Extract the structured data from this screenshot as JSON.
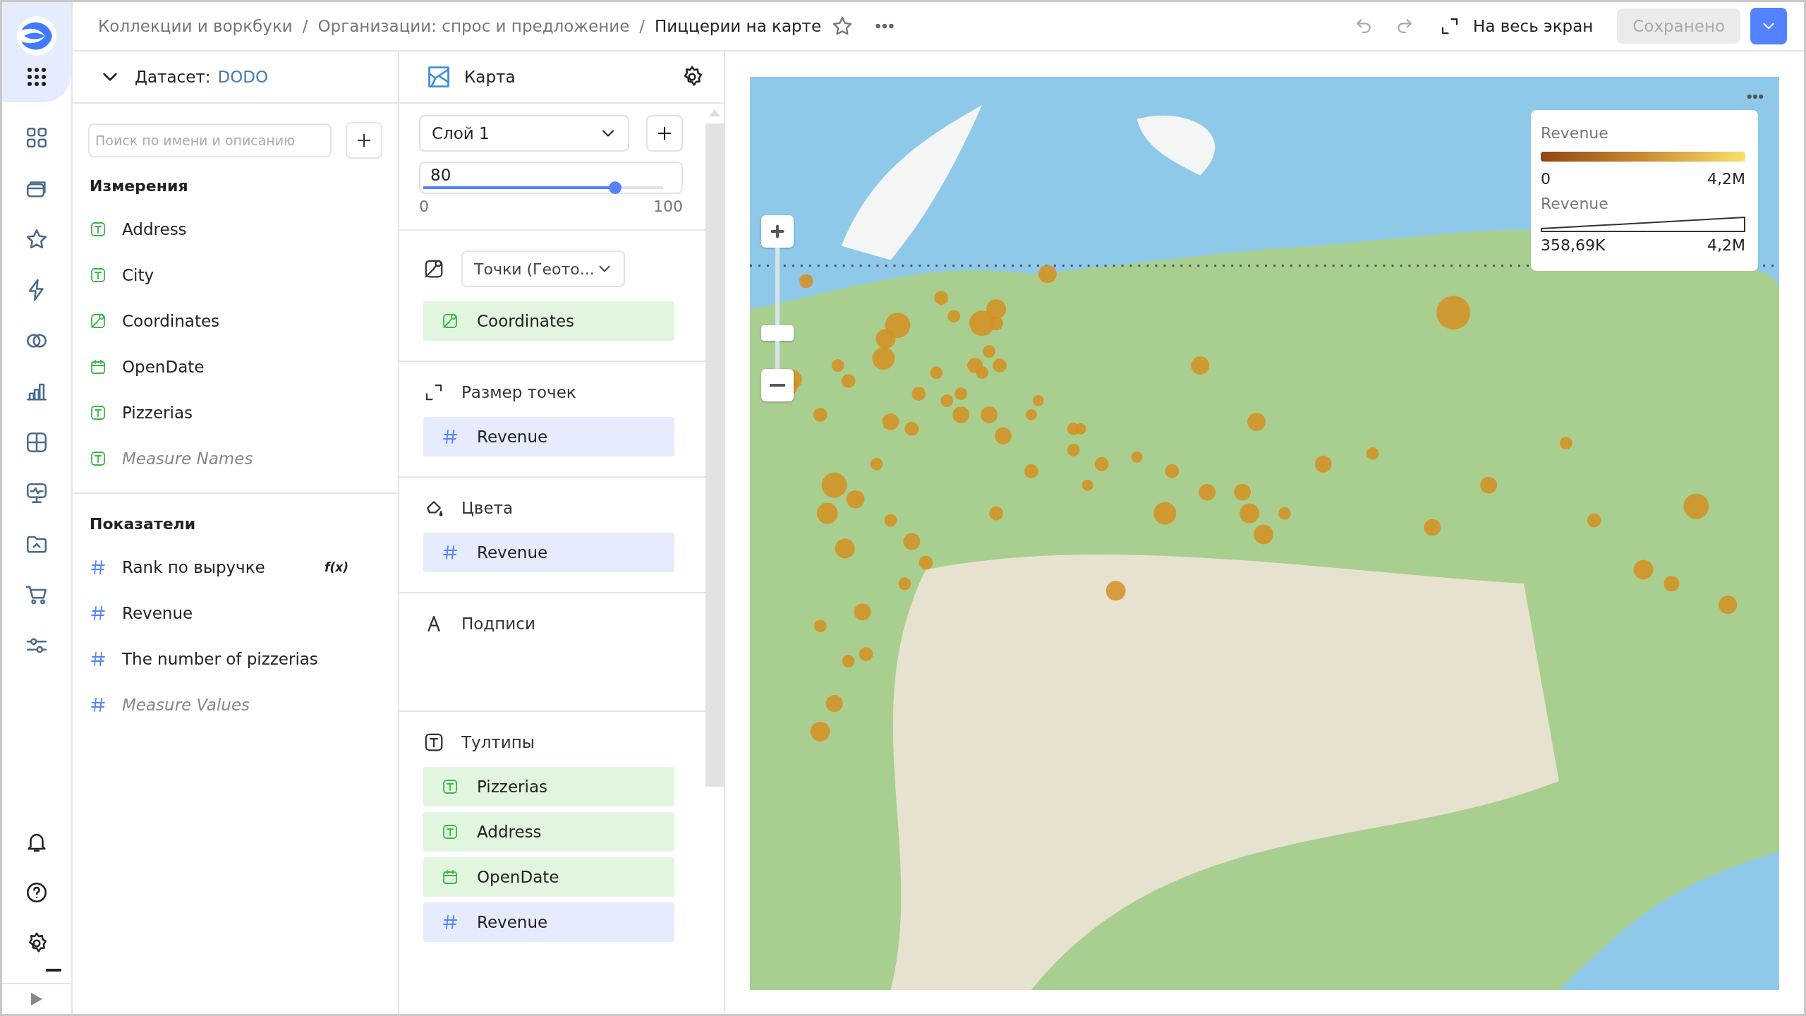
{
  "breadcrumbs": [
    {
      "label": "Коллекции и воркбуки",
      "current": false
    },
    {
      "separator": "/",
      "label": "Организации: спрос и предложение",
      "current": false
    },
    {
      "separator": "/",
      "label": "Пиццерии на карте",
      "current": true
    }
  ],
  "toolbar": {
    "fullscreen": "На весь экран",
    "save": "Сохранено",
    "save_disabled": true
  },
  "dataset": {
    "label": "Датасет:",
    "name": "DODO",
    "search_placeholder": "Поиск по имени и описанию",
    "sections": [
      {
        "title": "Измерения",
        "fields": [
          {
            "name": "Address",
            "kind": "text",
            "virtual": false
          },
          {
            "name": "City",
            "kind": "text",
            "virtual": false
          },
          {
            "name": "Coordinates",
            "kind": "geo",
            "virtual": false
          },
          {
            "name": "OpenDate",
            "kind": "date",
            "virtual": false
          },
          {
            "name": "Pizzerias",
            "kind": "text",
            "virtual": false
          },
          {
            "name": "Measure Names",
            "kind": "text",
            "virtual": true
          }
        ]
      },
      {
        "title": "Показатели",
        "fields": [
          {
            "name": "Rank по выручке",
            "kind": "number",
            "virtual": false,
            "badge": "f(x)"
          },
          {
            "name": "Revenue",
            "kind": "number",
            "virtual": false
          },
          {
            "name": "The number of pizzerias",
            "kind": "number",
            "virtual": false
          },
          {
            "name": "Measure Values",
            "kind": "number",
            "virtual": true
          }
        ]
      }
    ]
  },
  "visualization": {
    "title": "Карта",
    "layer": "Слой 1",
    "opacity": {
      "value": "80",
      "level": 0.8,
      "min": "0",
      "max": "100"
    },
    "sections": [
      {
        "kind": "geotype",
        "select": "Точки (Геото...",
        "items": [
          {
            "name": "Coordinates",
            "kind": "geo"
          }
        ]
      },
      {
        "kind": "size",
        "title": "Размер точек",
        "items": [
          {
            "name": "Revenue",
            "kind": "number"
          }
        ]
      },
      {
        "kind": "colors",
        "title": "Цвета",
        "items": [
          {
            "name": "Revenue",
            "kind": "number"
          }
        ]
      },
      {
        "kind": "labels",
        "title": "Подписи"
      },
      {
        "kind": "tooltips",
        "title": "Тултипы",
        "items": [
          {
            "name": "Pizzerias",
            "kind": "text"
          },
          {
            "name": "Address",
            "kind": "text"
          },
          {
            "name": "OpenDate",
            "kind": "date"
          },
          {
            "name": "Revenue",
            "kind": "number"
          }
        ]
      }
    ]
  },
  "map": {
    "legend": {
      "color_title": "Revenue",
      "color_min": "0",
      "color_max": "4,2M",
      "size_title": "Revenue",
      "size_min": "358,69K",
      "size_max": "4,2M"
    }
  }
}
